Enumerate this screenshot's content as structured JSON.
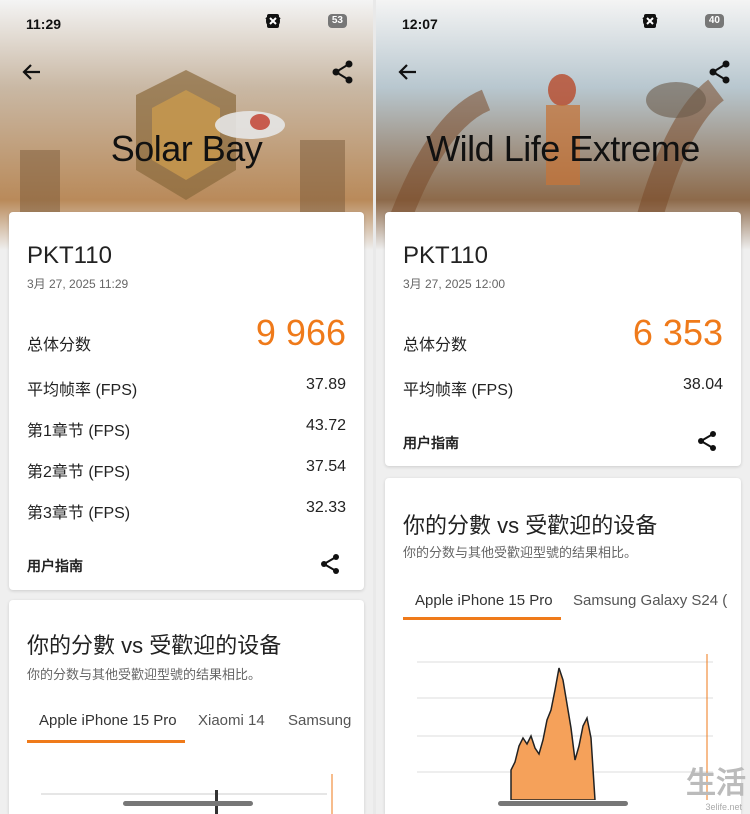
{
  "watermark": {
    "big": "生活",
    "small": "3elife.net"
  },
  "left": {
    "status": {
      "time": "11:29",
      "battery": "53"
    },
    "hero_title": "Solar Bay",
    "device": "PKT110",
    "date": "3月 27, 2025 11:29",
    "score_label": "总体分数",
    "score": "9 966",
    "rows": [
      {
        "label": "平均帧率 (FPS)",
        "value": "37.89"
      },
      {
        "label": "第1章节 (FPS)",
        "value": "43.72"
      },
      {
        "label": "第2章节 (FPS)",
        "value": "37.54"
      },
      {
        "label": "第3章节 (FPS)",
        "value": "32.33"
      }
    ],
    "guide": "用户指南",
    "compare_title": "你的分數 vs 受歡迎的设备",
    "compare_sub": "你的分数与其他受歡迎型號的结果相比。",
    "tabs": [
      "Apple iPhone 15 Pro",
      "Xiaomi 14",
      "Samsung"
    ]
  },
  "right": {
    "status": {
      "time": "12:07",
      "battery": "40"
    },
    "hero_title": "Wild Life Extreme",
    "device": "PKT110",
    "date": "3月 27, 2025 12:00",
    "score_label": "总体分数",
    "score": "6 353",
    "rows": [
      {
        "label": "平均帧率 (FPS)",
        "value": "38.04"
      }
    ],
    "guide": "用户指南",
    "compare_title": "你的分數 vs 受歡迎的设备",
    "compare_sub": "你的分数与其他受歡迎型號的结果相比。",
    "tabs": [
      "Apple iPhone 15 Pro",
      "Samsung Galaxy S24 ("
    ]
  },
  "colors": {
    "accent": "#ef7a1a",
    "hist_fill": "#f5a15a"
  }
}
